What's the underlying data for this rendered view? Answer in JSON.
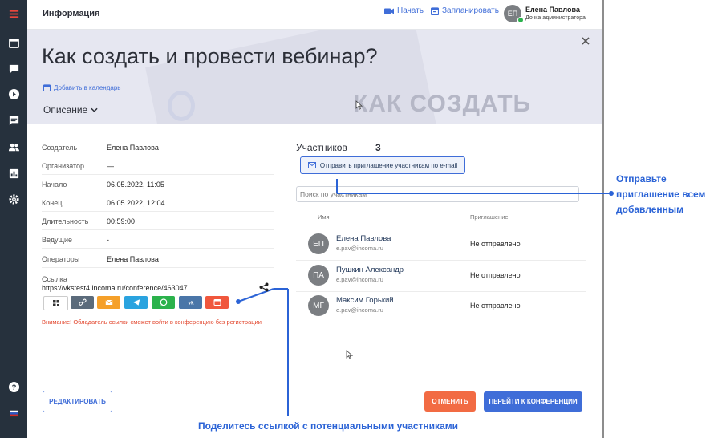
{
  "topbar": {
    "title": "Информация",
    "start_label": "Начать",
    "schedule_label": "Запланировать",
    "user_initials": "ЕП",
    "user_name": "Елена Павлова",
    "user_role": "Дочка администратора"
  },
  "hero": {
    "title": "Как создать и провести вебинар?",
    "add_calendar": "Добавить в календарь",
    "description_label": "Описание",
    "bg_text": "КАК СОЗДАТЬ"
  },
  "info": {
    "rows": [
      {
        "label": "Создатель",
        "value": "Елена Павлова"
      },
      {
        "label": "Организатор",
        "value": "—"
      },
      {
        "label": "Начало",
        "value": "06.05.2022, 11:05"
      },
      {
        "label": "Конец",
        "value": "06.05.2022, 12:04"
      },
      {
        "label": "Длительность",
        "value": "00:59:00"
      },
      {
        "label": "Ведущие",
        "value": "-"
      },
      {
        "label": "Операторы",
        "value": "Елена Павлова"
      }
    ],
    "link_label": "Ссылка",
    "link_url": "https://vkstest4.incoma.ru/conference/463047",
    "warning": "Внимание! Обладатель ссылки сможет войти в конференцию без регистрации"
  },
  "share_buttons": [
    {
      "icon": "qr-code-icon",
      "color": "#ffffff"
    },
    {
      "icon": "link-icon",
      "color": "#5b6b7b"
    },
    {
      "icon": "email-icon",
      "color": "#f5a02a"
    },
    {
      "icon": "telegram-icon",
      "color": "#2aa3df"
    },
    {
      "icon": "whatsapp-icon",
      "color": "#2bb24c"
    },
    {
      "icon": "vk-icon",
      "color": "#4a76a8"
    },
    {
      "icon": "calendar-icon",
      "color": "#f0573d"
    }
  ],
  "participants": {
    "title": "Участников",
    "count": "3",
    "invite_button": "Отправить приглашение участникам по e-mail",
    "search_placeholder": "Поиск по участникам",
    "col_name": "Имя",
    "col_invite": "Приглашение",
    "list": [
      {
        "initials": "ЕП",
        "name": "Елена Павлова",
        "email": "e.pav@incoma.ru",
        "status": "Не отправлено"
      },
      {
        "initials": "ПА",
        "name": "Пушкин Александр",
        "email": "e.pav@incoma.ru",
        "status": "Не отправлено"
      },
      {
        "initials": "МГ",
        "name": "Максим Горький",
        "email": "e.pav@incoma.ru",
        "status": "Не отправлено"
      }
    ]
  },
  "footer": {
    "edit_button": "РЕДАКТИРОВАТЬ",
    "cancel_button": "ОТМЕНИТЬ",
    "join_button": "ПЕРЕЙТИ К КОНФЕРЕНЦИИ"
  },
  "annotations": {
    "invite_line1": "Отправьте",
    "invite_line2": "приглашение всем",
    "invite_line3": "добавленным",
    "share": "Поделитесь ссылкой с потенциальными участниками"
  },
  "colors": {
    "sidebar": "#26313d",
    "accent": "#2b63d6",
    "warning": "#e2452c",
    "cancel": "#f26b43",
    "join": "#3f6dd8"
  }
}
